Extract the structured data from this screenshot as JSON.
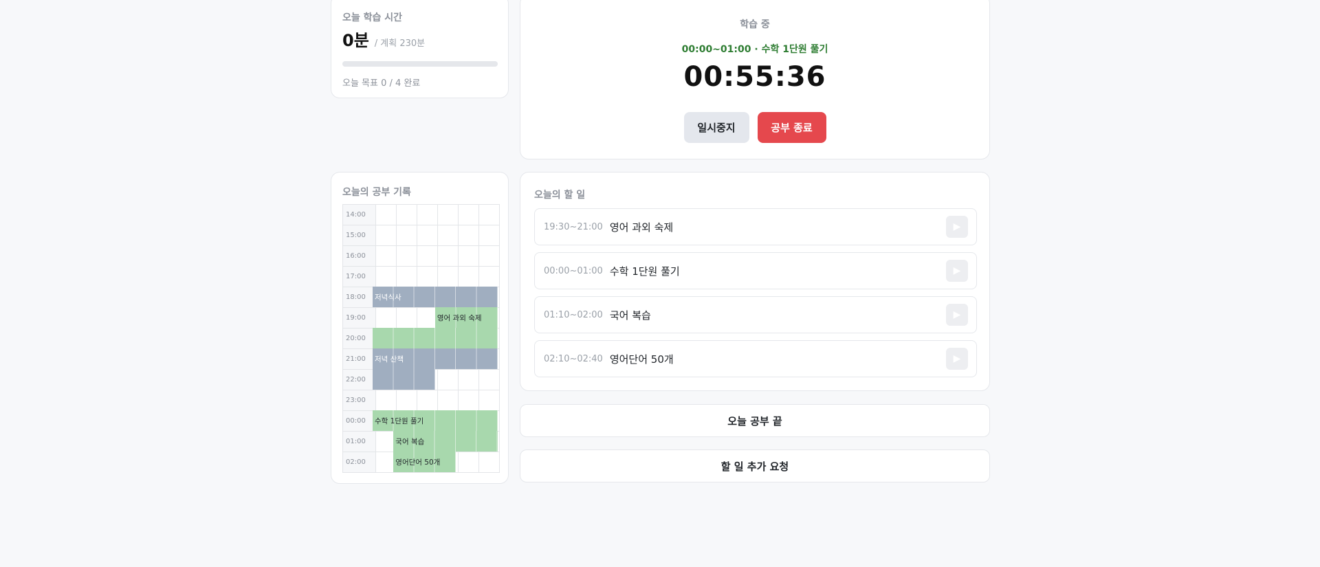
{
  "summary": {
    "title": "오늘 학습 시간",
    "minutes": "0분",
    "planned": "/ 계획 230분",
    "progress_percent": 0,
    "goal_text": "오늘 목표 0 / 4 완료"
  },
  "timer": {
    "status": "학습 중",
    "current_task": "00:00~01:00 · 수학 1단원 풀기",
    "clock": "00:55:36",
    "pause_label": "일시중지",
    "stop_label": "공부 종료"
  },
  "record": {
    "title": "오늘의 공부 기록",
    "hours": [
      "14:00",
      "15:00",
      "16:00",
      "17:00",
      "18:00",
      "19:00",
      "20:00",
      "21:00",
      "22:00",
      "23:00",
      "00:00",
      "01:00",
      "02:00"
    ],
    "blocks": [
      {
        "label": "저녁식사",
        "kind": "meal"
      },
      {
        "label": "영어 과외 숙제",
        "kind": "study"
      },
      {
        "label": "저녁 산책",
        "kind": "meal"
      },
      {
        "label": "수학 1단원 풀기",
        "kind": "study"
      },
      {
        "label": "국어 복습",
        "kind": "study"
      },
      {
        "label": "영어단어 50개",
        "kind": "study"
      }
    ]
  },
  "todo": {
    "title": "오늘의 할 일",
    "items": [
      {
        "time": "19:30~21:00",
        "name": "영어 과외 숙제",
        "icon": "play-icon"
      },
      {
        "time": "00:00~01:00",
        "name": "수학 1단원 풀기",
        "icon": "play-icon"
      },
      {
        "time": "01:10~02:00",
        "name": "국어 복습",
        "icon": "play-icon"
      },
      {
        "time": "02:10~02:40",
        "name": "영어단어 50개",
        "icon": "play-icon"
      }
    ]
  },
  "actions": {
    "end_day": "오늘 공부 끝",
    "add_task": "할 일 추가 요청"
  },
  "colors": {
    "accent_green": "#2e7d32",
    "danger": "#e5484d",
    "meal_block": "#a0aec0",
    "study_block": "#a8d8ad"
  }
}
